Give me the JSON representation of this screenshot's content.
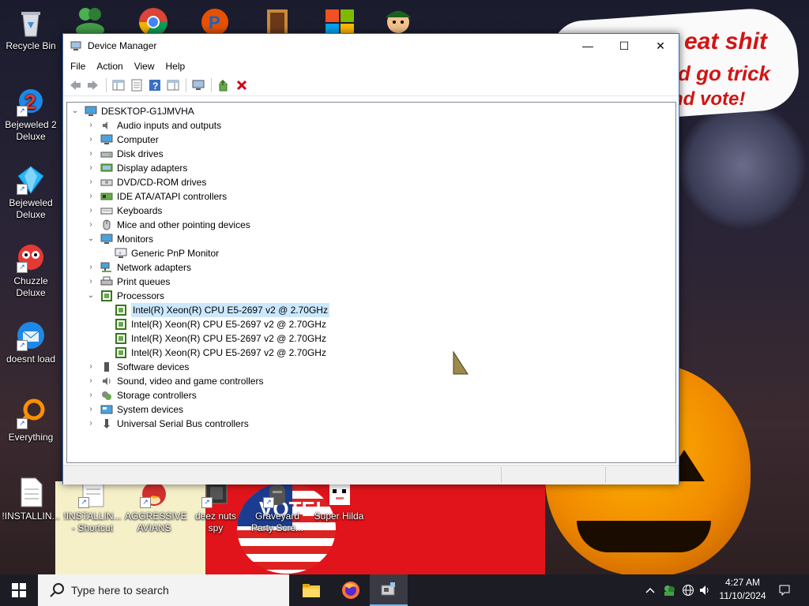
{
  "wallpaper": {
    "speech_lines": [
      "eat shit",
      "d go trick",
      "nd vote!"
    ],
    "poster_text": "VOTE!"
  },
  "desktop_icons": [
    {
      "label": "Recycle Bin",
      "icon": "recycle-bin-icon"
    },
    {
      "label": "Bejeweled 2 Deluxe",
      "icon": "bejeweled2-icon"
    },
    {
      "label": "Bejeweled Deluxe",
      "icon": "bejeweled-icon"
    },
    {
      "label": "Chuzzle Deluxe",
      "icon": "chuzzle-icon"
    },
    {
      "label": "doesnt load",
      "icon": "thunderbird-icon"
    },
    {
      "label": "Everything",
      "icon": "everything-search-icon"
    },
    {
      "label": "!INSTALLIN...",
      "icon": "text-file-icon"
    },
    {
      "label": "!INSTALLIN... - Shortcut",
      "icon": "text-file-shortcut-icon"
    },
    {
      "label": "AGGRESSIVE AVIANS",
      "icon": "angry-bird-icon"
    },
    {
      "label": "deez nuts spy",
      "icon": "spy-icon"
    },
    {
      "label": "Graveyard Party Scre...",
      "icon": "graveyard-icon"
    },
    {
      "label": "Super Hilda",
      "icon": "pixel-cat-icon"
    }
  ],
  "window": {
    "title": "Device Manager",
    "controls": {
      "minimize": "—",
      "maximize": "☐",
      "close": "✕"
    },
    "menu": [
      "File",
      "Action",
      "View",
      "Help"
    ],
    "tree": {
      "root": "DESKTOP-G1JMVHA",
      "categories": [
        {
          "label": "Audio inputs and outputs",
          "expanded": false,
          "icon": "audio-icon"
        },
        {
          "label": "Computer",
          "expanded": false,
          "icon": "computer-icon"
        },
        {
          "label": "Disk drives",
          "expanded": false,
          "icon": "disk-icon"
        },
        {
          "label": "Display adapters",
          "expanded": false,
          "icon": "display-adapter-icon"
        },
        {
          "label": "DVD/CD-ROM drives",
          "expanded": false,
          "icon": "dvd-icon"
        },
        {
          "label": "IDE ATA/ATAPI controllers",
          "expanded": false,
          "icon": "ide-icon"
        },
        {
          "label": "Keyboards",
          "expanded": false,
          "icon": "keyboard-icon"
        },
        {
          "label": "Mice and other pointing devices",
          "expanded": false,
          "icon": "mouse-icon"
        },
        {
          "label": "Monitors",
          "expanded": true,
          "icon": "monitor-icon",
          "children": [
            "Generic PnP Monitor"
          ]
        },
        {
          "label": "Network adapters",
          "expanded": false,
          "icon": "network-icon"
        },
        {
          "label": "Print queues",
          "expanded": false,
          "icon": "printer-icon"
        },
        {
          "label": "Processors",
          "expanded": true,
          "icon": "processor-icon",
          "children": [
            "Intel(R) Xeon(R) CPU E5-2697 v2 @ 2.70GHz",
            "Intel(R) Xeon(R) CPU E5-2697 v2 @ 2.70GHz",
            "Intel(R) Xeon(R) CPU E5-2697 v2 @ 2.70GHz",
            "Intel(R) Xeon(R) CPU E5-2697 v2 @ 2.70GHz"
          ]
        },
        {
          "label": "Software devices",
          "expanded": false,
          "icon": "software-device-icon"
        },
        {
          "label": "Sound, video and game controllers",
          "expanded": false,
          "icon": "sound-icon"
        },
        {
          "label": "Storage controllers",
          "expanded": false,
          "icon": "storage-icon"
        },
        {
          "label": "System devices",
          "expanded": false,
          "icon": "system-icon"
        },
        {
          "label": "Universal Serial Bus controllers",
          "expanded": false,
          "icon": "usb-icon"
        }
      ]
    }
  },
  "taskbar": {
    "search_placeholder": "Type here to search",
    "time": "4:27 AM",
    "date": "11/10/2024"
  },
  "colors": {
    "accent": "#0078d7",
    "selection": "#cce8ff",
    "close_red": "#e81123"
  }
}
